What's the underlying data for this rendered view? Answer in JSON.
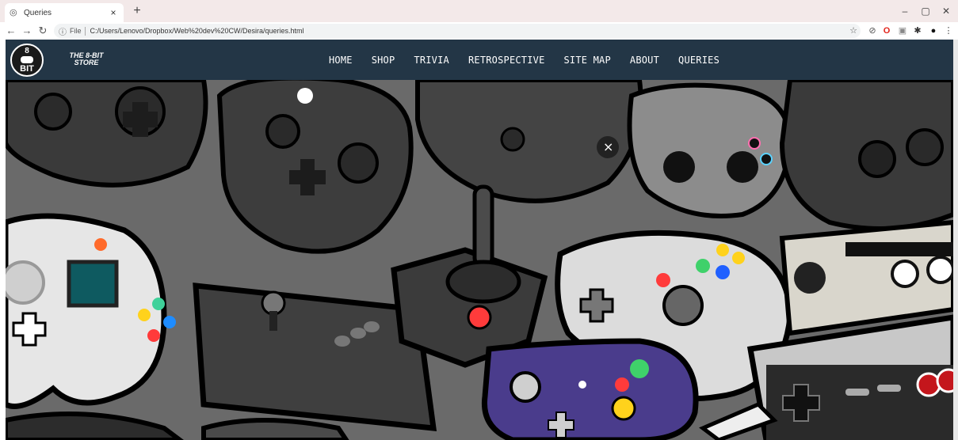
{
  "browser": {
    "tab_title": "Queries",
    "tab_close": "×",
    "new_tab": "+",
    "window_controls": [
      "–",
      "▢",
      "✕"
    ],
    "address": {
      "scheme_label": "File",
      "url": "C:/Users/Lenovo/Dropbox/Web%20dev%20CW/Desira/queries.html"
    },
    "icons": [
      "star-icon",
      "block-icon",
      "opera-icon",
      "extension-icon",
      "puzzle-icon",
      "profile-icon",
      "menu-icon"
    ]
  },
  "site": {
    "logo": {
      "number": "8",
      "word": "BIT"
    },
    "brand_line1": "THE 8-BIT",
    "brand_line2": "STORE",
    "nav": [
      "HOME",
      "SHOP",
      "TRIVIA",
      "RETROSPECTIVE",
      "SITE MAP",
      "ABOUT",
      "QUERIES"
    ]
  },
  "colors": {
    "navbar": "#233646",
    "hero_bg": "#6e6e6e",
    "tab_strip": "#f3e9e9"
  }
}
